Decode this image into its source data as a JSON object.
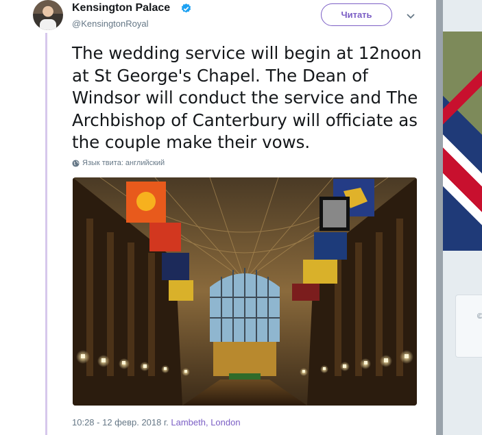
{
  "tweet": {
    "author_name": "Kensington Palace",
    "author_handle": "@KensingtonRoyal",
    "follow_label": "Читать",
    "text": "The wedding service will begin at 12noon at St George's Chapel. The Dean of Windsor will conduct the service and The Archbishop of Canterbury will officiate as the couple make their vows.",
    "language_note": "Язык твита: английский",
    "timestamp": "10:28 - 12 февр. 2018 г.",
    "location": "Lambeth, London"
  },
  "icons": {
    "verified": "verified-badge-icon",
    "caret": "chevron-down-icon",
    "globe": "globe-icon"
  },
  "colors": {
    "accent": "#7b5ec5",
    "verified": "#1da1f2",
    "thread_line": "#d6c7ec",
    "secondary_text": "#657786"
  }
}
